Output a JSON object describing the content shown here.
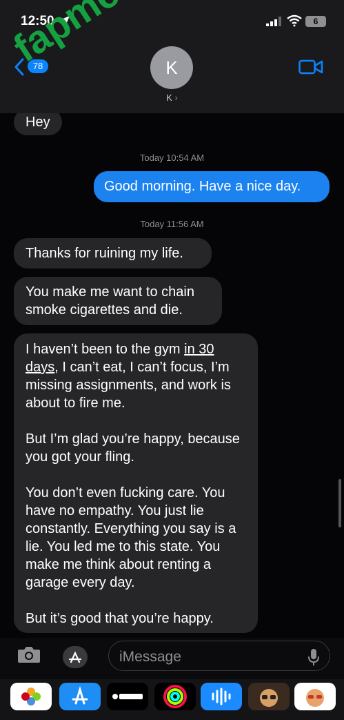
{
  "status": {
    "time": "12:50",
    "battery": "6"
  },
  "header": {
    "back_count": "78",
    "avatar_letter": "K",
    "contact_name": "K"
  },
  "conversation": {
    "hey": "Hey",
    "ts1": "Today 10:54 AM",
    "out1": "Good morning. Have a nice day.",
    "ts2": "Today 11:56 AM",
    "msg1": "Thanks for ruining my life.",
    "msg2": "You make me want to chain smoke cigarettes and die.",
    "msg3_p1_before": "I haven’t been to the gym ",
    "msg3_p1_underlined": "in 30 days",
    "msg3_p1_after": ", I can’t eat, I can’t focus, I’m missing assignments, and work is about to fire me.",
    "msg3_p2": "But I’m glad you’re happy, because you got your fling.",
    "msg3_p3": "You don’t even fucking care. You have no empathy. You just lie constantly. Everything you say is a lie. You led me to this state. You make me think about renting a garage every day.",
    "msg3_p4": "But it’s good that you’re happy."
  },
  "composer": {
    "placeholder": "iMessage"
  },
  "watermark": "fapmenu.com",
  "colors": {
    "accent": "#0a84ff",
    "bubble_in": "#262628",
    "bubble_out": "#1b82f0",
    "watermark": "#15a843"
  }
}
